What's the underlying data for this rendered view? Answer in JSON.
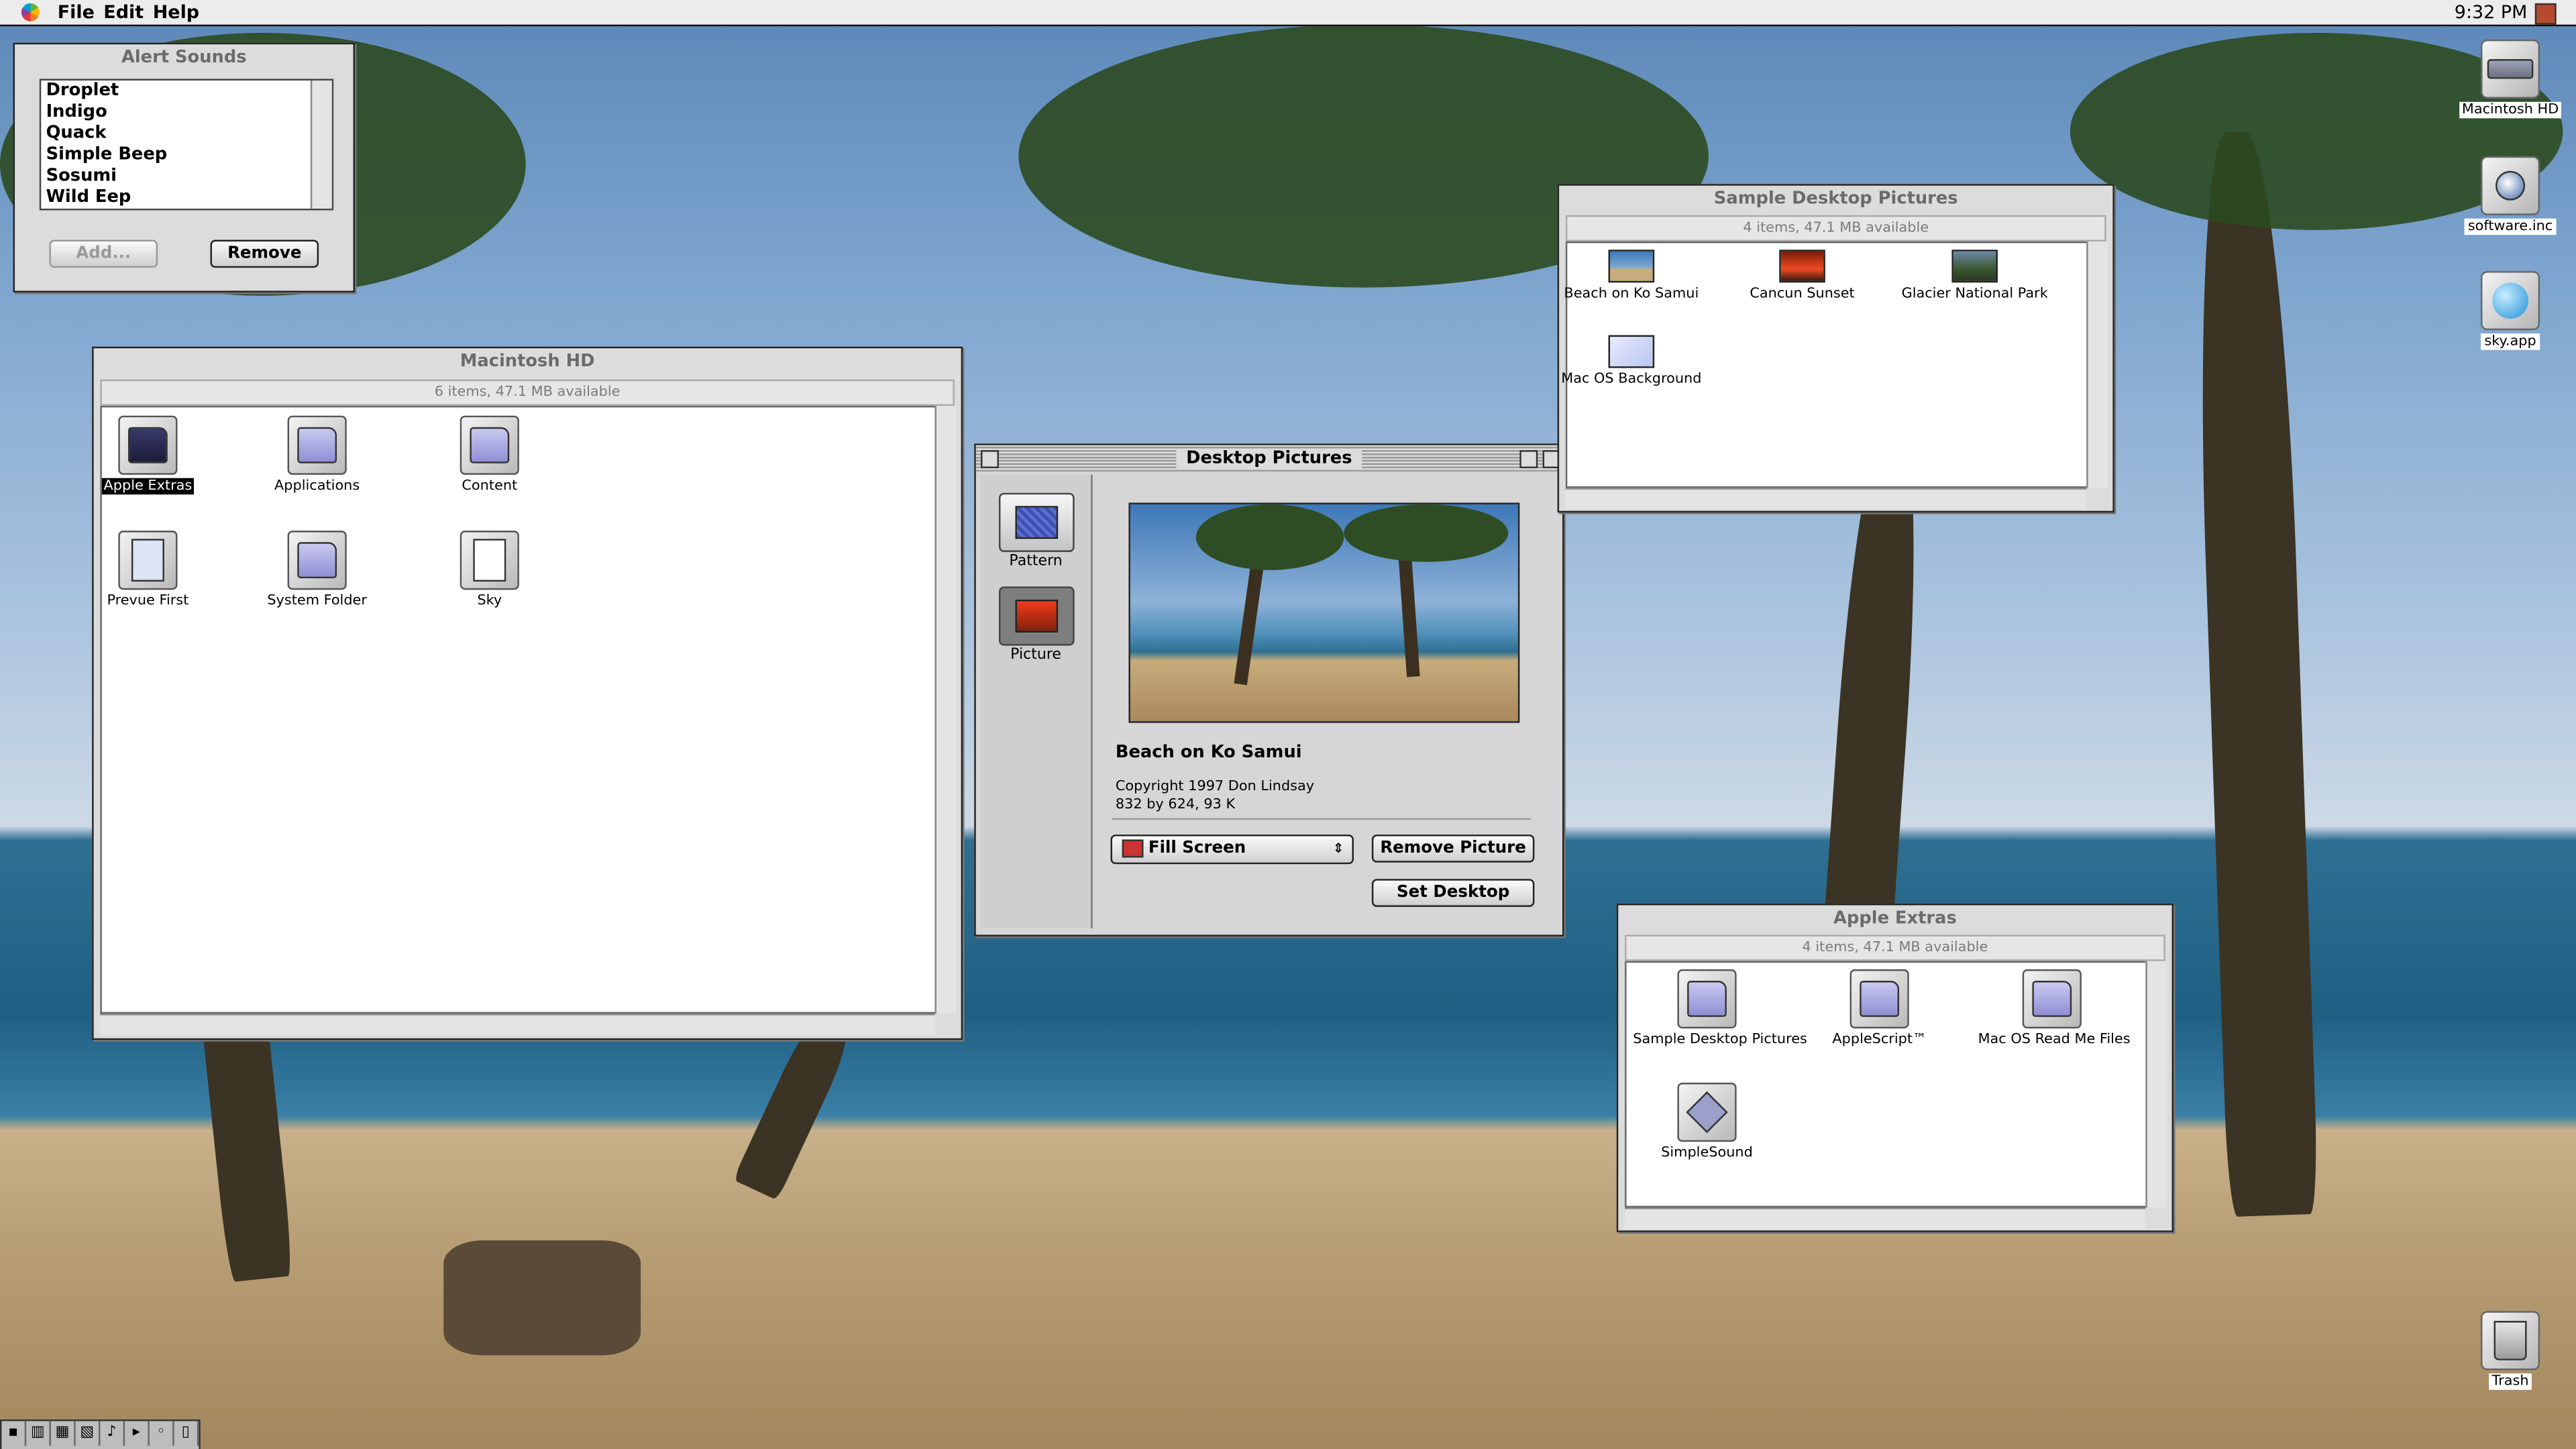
{
  "menubar": {
    "apple_icon": "apple-rainbow-icon",
    "items": [
      "File",
      "Edit",
      "Help"
    ],
    "clock": "9:32 PM",
    "app_icon": "application-switcher-icon"
  },
  "alert_sounds": {
    "title": "Alert Sounds",
    "sounds": [
      "Droplet",
      "Indigo",
      "Quack",
      "Simple Beep",
      "Sosumi",
      "Wild Eep"
    ],
    "add_label": "Add...",
    "remove_label": "Remove"
  },
  "macintosh_hd_window": {
    "title": "Macintosh HD",
    "info": "6 items, 47.1 MB available",
    "items": [
      {
        "label": "Apple Extras",
        "icon": "folder-icon"
      },
      {
        "label": "Applications",
        "icon": "folder-icon"
      },
      {
        "label": "Content",
        "icon": "folder-icon"
      },
      {
        "label": "Prevue First",
        "icon": "movie-document-icon"
      },
      {
        "label": "System Folder",
        "icon": "system-folder-icon"
      },
      {
        "label": "Sky",
        "icon": "document-icon"
      }
    ]
  },
  "desktop_pictures": {
    "title": "Desktop Pictures",
    "tabs": [
      {
        "label": "Pattern",
        "icon": "pattern-icon"
      },
      {
        "label": "Picture",
        "icon": "picture-icon"
      }
    ],
    "picture_name": "Beach on Ko Samui",
    "copyright": "Copyright 1997 Don Lindsay",
    "dimensions": "832 by 624, 93 K",
    "position_selected": "Fill Screen",
    "remove_label": "Remove Picture",
    "set_label": "Set Desktop"
  },
  "sample_pictures_window": {
    "title": "Sample Desktop Pictures",
    "info": "4 items, 47.1 MB available",
    "items": [
      {
        "label": "Beach on Ko Samui",
        "icon": "beach-picture-icon"
      },
      {
        "label": "Cancun Sunset",
        "icon": "sunset-picture-icon"
      },
      {
        "label": "Glacier National Park",
        "icon": "mountain-picture-icon"
      },
      {
        "label": "Mac OS Background",
        "icon": "macos-picture-icon"
      }
    ]
  },
  "apple_extras_window": {
    "title": "Apple Extras",
    "info": "4 items, 47.1 MB available",
    "items": [
      {
        "label": "Sample Desktop Pictures",
        "icon": "folder-icon"
      },
      {
        "label": "AppleScript™",
        "icon": "folder-icon"
      },
      {
        "label": "Mac OS Read Me Files",
        "icon": "folder-icon"
      },
      {
        "label": "SimpleSound",
        "icon": "simplesound-icon"
      }
    ]
  },
  "desktop_icons": [
    {
      "label": "Macintosh HD",
      "icon": "hard-disk-icon"
    },
    {
      "label": "software.inc",
      "icon": "globe-document-icon"
    },
    {
      "label": "sky.app",
      "icon": "sky-app-icon"
    },
    {
      "label": "Trash",
      "icon": "trash-icon"
    }
  ]
}
